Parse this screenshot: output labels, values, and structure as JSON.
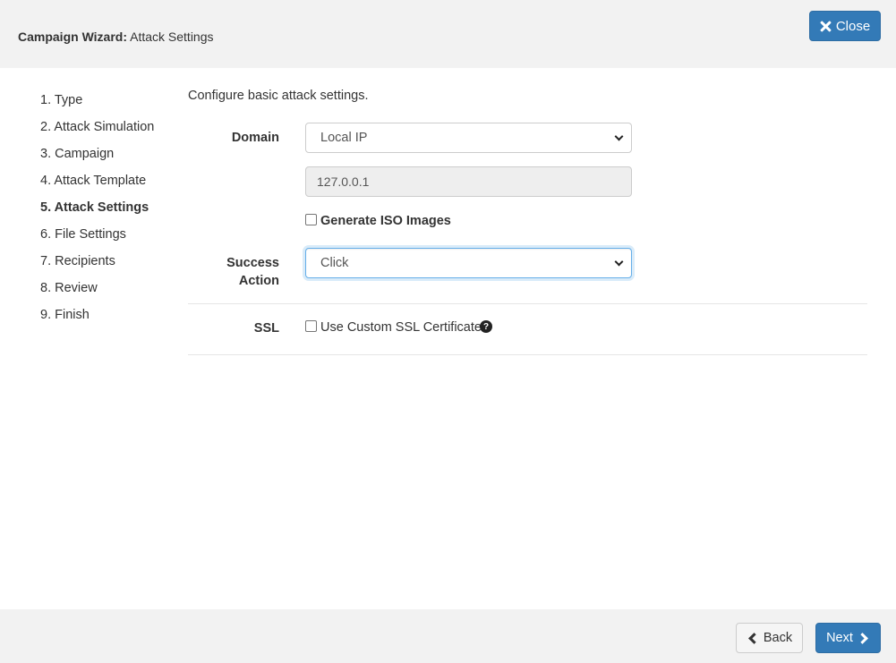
{
  "header": {
    "title_bold": "Campaign Wizard:",
    "title_rest": " Attack Settings",
    "close_label": "Close"
  },
  "steps": [
    {
      "label": "1. Type",
      "active": false
    },
    {
      "label": "2. Attack Simulation",
      "active": false
    },
    {
      "label": "3. Campaign",
      "active": false
    },
    {
      "label": "4. Attack Template",
      "active": false
    },
    {
      "label": "5. Attack Settings",
      "active": true
    },
    {
      "label": "6. File Settings",
      "active": false
    },
    {
      "label": "7. Recipients",
      "active": false
    },
    {
      "label": "8. Review",
      "active": false
    },
    {
      "label": "9. Finish",
      "active": false
    }
  ],
  "form": {
    "intro": "Configure basic attack settings.",
    "domain_label": "Domain",
    "domain_value": "Local IP",
    "ip_value": "127.0.0.1",
    "iso_label": "Generate ISO Images",
    "iso_checked": false,
    "success_label_line1": "Success",
    "success_label_line2": "Action",
    "success_value": "Click",
    "ssl_label": "SSL",
    "ssl_checkbox_label": "Use Custom SSL Certificate",
    "ssl_checked": false
  },
  "footer": {
    "back_label": "Back",
    "next_label": "Next"
  },
  "colors": {
    "primary": "#337ab7",
    "header_bg": "#f2f2f2"
  },
  "icons": [
    "close-icon",
    "help-icon",
    "chevron-left-icon",
    "chevron-right-icon",
    "chevron-down-icon"
  ]
}
